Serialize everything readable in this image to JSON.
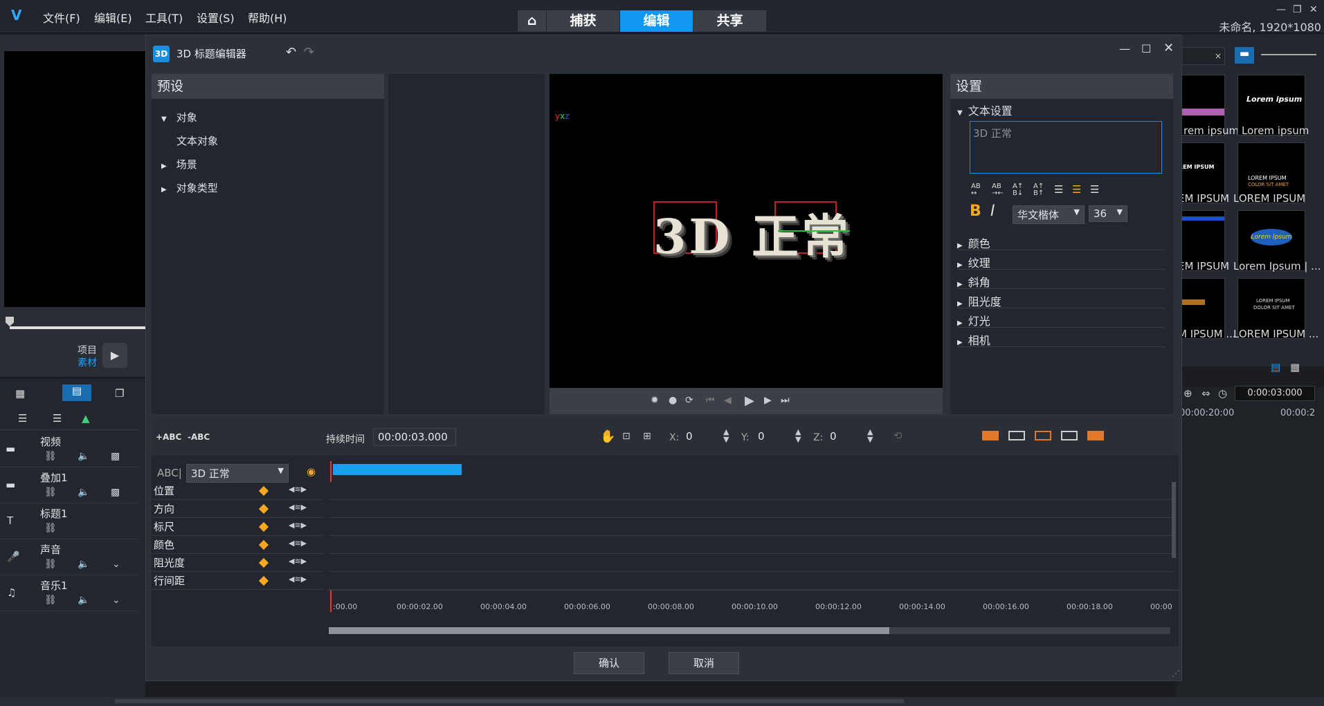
{
  "menubar": {
    "items": [
      "文件(F)",
      "编辑(E)",
      "工具(T)",
      "设置(S)",
      "帮助(H)"
    ],
    "tabs": [
      "捕获",
      "编辑",
      "共享"
    ],
    "active_tab": "编辑",
    "project": "未命名, 1920*1080"
  },
  "left": {
    "ctrl_project": "项目",
    "ctrl_clip": "素材"
  },
  "tracks": [
    {
      "name": "视频"
    },
    {
      "name": "叠加1"
    },
    {
      "name": "标题1"
    },
    {
      "name": "声音"
    },
    {
      "name": "音乐1"
    }
  ],
  "library": {
    "labels": [
      "rem ipsum",
      "Lorem ipsum",
      "EM IPSUM",
      "LOREM IPSUM",
      "EM IPSUM",
      "Lorem Ipsum | ...",
      "M IPSUM ...",
      "LOREM IPSUM ..."
    ],
    "thumb_texts": [
      "Lorem ipsum",
      "REM IPSUM",
      "LOREM IPSUM",
      "COLOR SIT AMET",
      "Lorem Ipsum",
      "LOREM IPSUM",
      "DOLOR SIT AMET"
    ],
    "timecode": "0:00:03:000",
    "ruler": [
      "00:00:20:00",
      "00:00:2"
    ]
  },
  "dialog": {
    "title": "3D 标题编辑器",
    "icon_text": "3D",
    "presets": {
      "header": "预设",
      "tree": [
        "对象",
        "文本对象",
        "场景",
        "对象类型"
      ]
    },
    "preview_text": "3D 正常",
    "settings": {
      "header": "设置",
      "section": "文本设置",
      "text_value": "3D 正常",
      "font": "华文楷体",
      "size": "36",
      "bold": "B",
      "italic": "I",
      "fmt_labels": [
        "AB",
        "AB",
        "A↑",
        "A↑"
      ],
      "sections": [
        "颜色",
        "纹理",
        "斜角",
        "阻光度",
        "灯光",
        "相机"
      ]
    },
    "timeline": {
      "add_label": "+ABC",
      "remove_label": "-ABC",
      "duration_label": "持续时间",
      "duration": "00:00:03.000",
      "x_label": "X:",
      "x": "0",
      "y_label": "Y:",
      "y": "0",
      "z_label": "Z:",
      "z": "0",
      "abc_label": "ABC|",
      "object_select": "3D 正常",
      "props": [
        "位置",
        "方向",
        "标尺",
        "颜色",
        "阻光度",
        "行间距"
      ],
      "ticks": [
        ":00.00",
        "00:00:02.00",
        "00:00:04.00",
        "00:00:06.00",
        "00:00:08.00",
        "00:00:10.00",
        "00:00:12.00",
        "00:00:14.00",
        "00:00:16.00",
        "00:00:18.00",
        "00:00"
      ]
    },
    "ok": "确认",
    "cancel": "取消"
  }
}
